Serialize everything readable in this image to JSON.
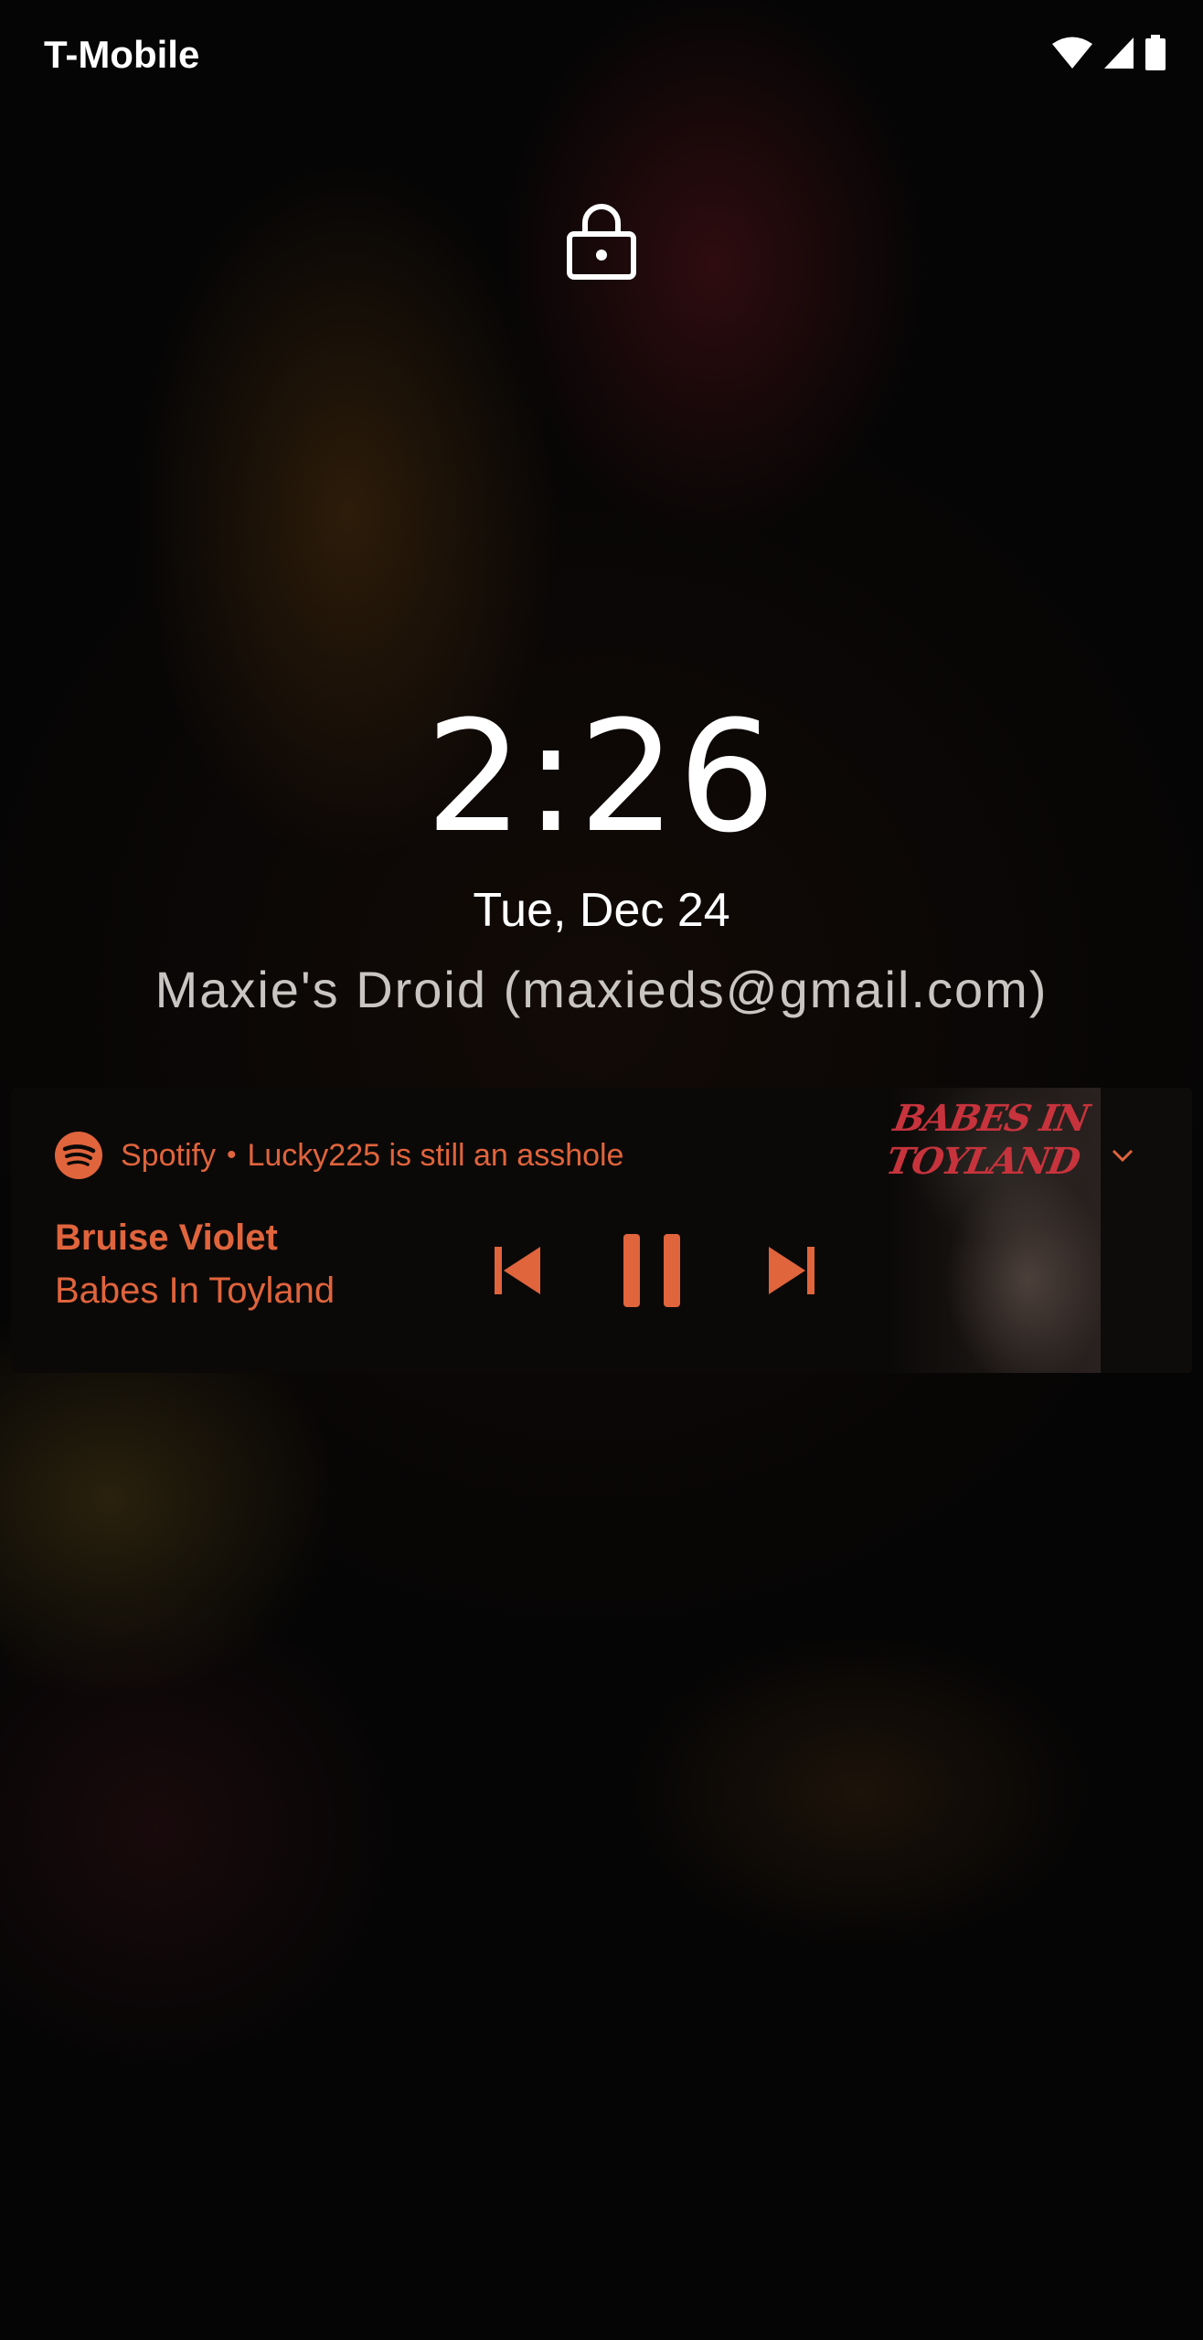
{
  "status_bar": {
    "carrier": "T-Mobile",
    "icons": [
      "wifi-icon",
      "cellular-signal-icon",
      "battery-icon"
    ]
  },
  "lockscreen": {
    "lock_icon": "lock-icon",
    "time": "2:26",
    "date": "Tue, Dec 24",
    "owner_info": "Maxie's Droid (maxieds@gmail.com)"
  },
  "media_notification": {
    "app_icon": "spotify-icon",
    "app_name": "Spotify",
    "separator": "•",
    "subtext": "Lucky225 is still an asshole",
    "song_title": "Bruise Violet",
    "artist": "Babes In Toyland",
    "album_art_text": "BABES IN TOYLAND",
    "controls": [
      "skip-previous-icon",
      "pause-icon",
      "skip-next-icon"
    ],
    "accent_color": "#e0643c"
  },
  "colors": {
    "background": "#050505",
    "text_primary": "#ffffff",
    "text_secondary": "#c9c5c2",
    "card_background": "#0b0908"
  }
}
